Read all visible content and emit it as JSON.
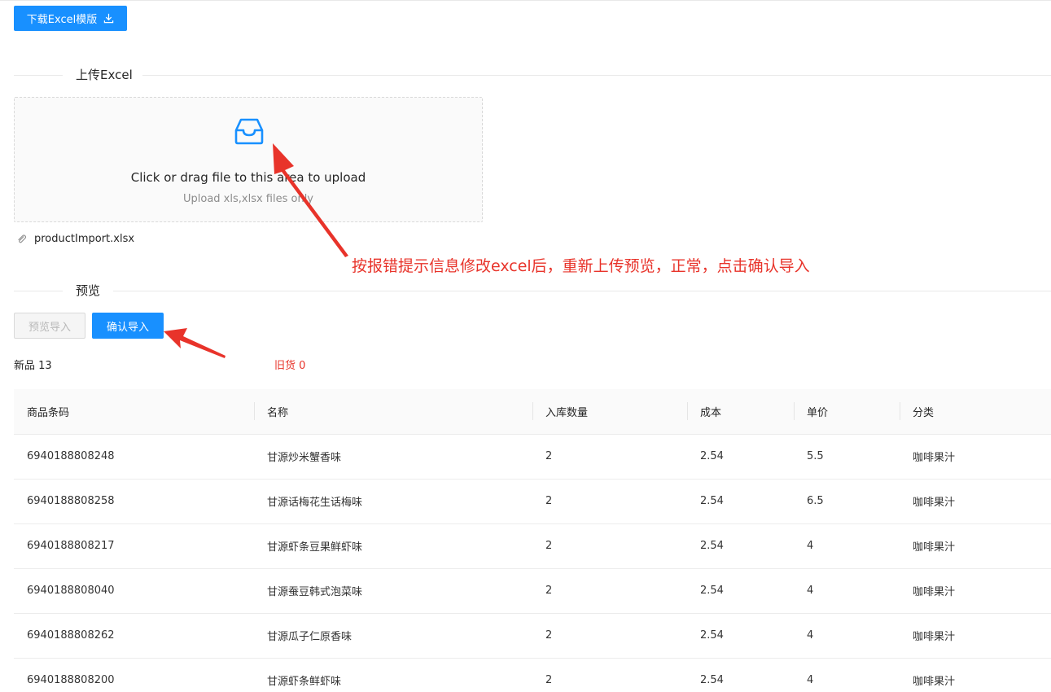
{
  "toolbar": {
    "download_label": "下载Excel模版"
  },
  "upload_section": {
    "title": "上传Excel",
    "drop_text": "Click or drag file to this area to upload",
    "hint_text": "Upload xls,xlsx files only",
    "file_name": "productImport.xlsx"
  },
  "annotation": {
    "text": "按报错提示信息修改excel后，重新上传预览，正常，点击确认导入",
    "color": "#e8332a"
  },
  "preview_section": {
    "title": "预览",
    "preview_label": "预览导入",
    "confirm_label": "确认导入"
  },
  "counts": {
    "new_label": "新品 13",
    "old_label": "旧货 0"
  },
  "table": {
    "headers": [
      "商品条码",
      "名称",
      "入库数量",
      "成本",
      "单价",
      "分类"
    ],
    "rows": [
      [
        "6940188808248",
        "甘源炒米蟹香味",
        "2",
        "2.54",
        "5.5",
        "咖啡果汁"
      ],
      [
        "6940188808258",
        "甘源话梅花生话梅味",
        "2",
        "2.54",
        "6.5",
        "咖啡果汁"
      ],
      [
        "6940188808217",
        "甘源虾条豆果鲜虾味",
        "2",
        "2.54",
        "4",
        "咖啡果汁"
      ],
      [
        "6940188808040",
        "甘源蚕豆韩式泡菜味",
        "2",
        "2.54",
        "4",
        "咖啡果汁"
      ],
      [
        "6940188808262",
        "甘源瓜子仁原香味",
        "2",
        "2.54",
        "4",
        "咖啡果汁"
      ],
      [
        "6940188808200",
        "甘源虾条鲜虾味",
        "2",
        "2.54",
        "4",
        "咖啡果汁"
      ]
    ]
  },
  "colors": {
    "primary": "#1890ff",
    "annotation_red": "#e8332a"
  },
  "icons": {
    "download": "download-icon",
    "inbox": "inbox-icon",
    "attachment": "paperclip-icon"
  }
}
